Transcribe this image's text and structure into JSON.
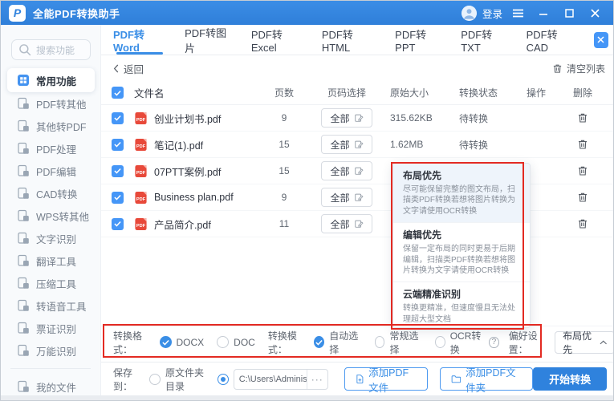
{
  "titlebar": {
    "app_title": "全能PDF转换助手",
    "login_label": "登录"
  },
  "sidebar": {
    "search_placeholder": "搜索功能",
    "items": [
      {
        "label": "常用功能",
        "active": true
      },
      {
        "label": "PDF转其他",
        "active": false
      },
      {
        "label": "其他转PDF",
        "active": false
      },
      {
        "label": "PDF处理",
        "active": false
      },
      {
        "label": "PDF编辑",
        "active": false
      },
      {
        "label": "CAD转换",
        "active": false
      },
      {
        "label": "WPS转其他",
        "active": false
      },
      {
        "label": "文字识别",
        "active": false
      },
      {
        "label": "翻译工具",
        "active": false
      },
      {
        "label": "压缩工具",
        "active": false
      },
      {
        "label": "转语音工具",
        "active": false
      },
      {
        "label": "票证识别",
        "active": false
      },
      {
        "label": "万能识别",
        "active": false
      }
    ],
    "footer_item": {
      "label": "我的文件"
    }
  },
  "tabs": {
    "active": "PDF转Word",
    "items": [
      {
        "label": "PDF转Word"
      },
      {
        "label": "PDF转图片"
      },
      {
        "label": "PDF转Excel"
      },
      {
        "label": "PDF转HTML"
      },
      {
        "label": "PDF转PPT"
      },
      {
        "label": "PDF转TXT"
      },
      {
        "label": "PDF转CAD"
      }
    ]
  },
  "toolbar": {
    "back_label": "返回",
    "clear_label": "清空列表"
  },
  "table": {
    "headers": {
      "name": "文件名",
      "pages": "页数",
      "page_select": "页码选择",
      "size": "原始大小",
      "status": "转换状态",
      "action": "操作",
      "delete": "删除"
    },
    "page_select_label": "全部",
    "all_checked": true,
    "rows": [
      {
        "name": "创业计划书.pdf",
        "pages": "9",
        "size": "315.62KB",
        "status": "待转换",
        "checked": true
      },
      {
        "name": "笔记(1).pdf",
        "pages": "15",
        "size": "1.62MB",
        "status": "待转换",
        "checked": true
      },
      {
        "name": "07PTT案例.pdf",
        "pages": "15",
        "size": "",
        "status": "",
        "checked": true
      },
      {
        "name": "Business plan.pdf",
        "pages": "9",
        "size": "",
        "status": "",
        "checked": true
      },
      {
        "name": "产品简介.pdf",
        "pages": "11",
        "size": "",
        "status": "",
        "checked": true
      }
    ]
  },
  "preference_popup": {
    "options": [
      {
        "title": "布局优先",
        "desc": "尽可能保留完整的图文布局，扫描类PDF转换若想将图片转换为文字请使用OCR转换",
        "selected": true
      },
      {
        "title": "编辑优先",
        "desc": "保留一定布局的同时更易于后期编辑，扫描类PDF转换若想将图片转换为文字请使用OCR转换",
        "selected": false
      },
      {
        "title": "云端精准识别",
        "desc": "转换更精准，但速度慢且无法处理超大型文档",
        "selected": false
      }
    ]
  },
  "options_bar": {
    "format_label": "转换格式：",
    "format_options": [
      {
        "label": "DOCX",
        "checked": true
      },
      {
        "label": "DOC",
        "checked": false
      }
    ],
    "mode_label": "转换模式：",
    "mode_options": [
      {
        "label": "自动选择",
        "checked": true
      },
      {
        "label": "常规选择",
        "checked": false
      },
      {
        "label": "OCR转换",
        "checked": false
      }
    ],
    "help_glyph": "?",
    "preference_label": "偏好设置：",
    "preference_value": "布局优先"
  },
  "bottom_bar": {
    "save_label": "保存到：",
    "source_folder_option": {
      "label": "原文件夹目录",
      "checked": false
    },
    "custom_path_option": {
      "checked": true
    },
    "path_value": "C:\\Users\\Adminis...",
    "more_label": "···",
    "add_file_label": "添加PDF文件",
    "add_folder_label": "添加PDF文件夹",
    "start_label": "开始转换"
  },
  "colors": {
    "titlebar_blue": "#3287e2",
    "accent_blue": "#3a8ee6",
    "annotation_red": "#e32a22",
    "pdf_icon_red": "#e8493a",
    "status_gray": "#5f6670"
  }
}
